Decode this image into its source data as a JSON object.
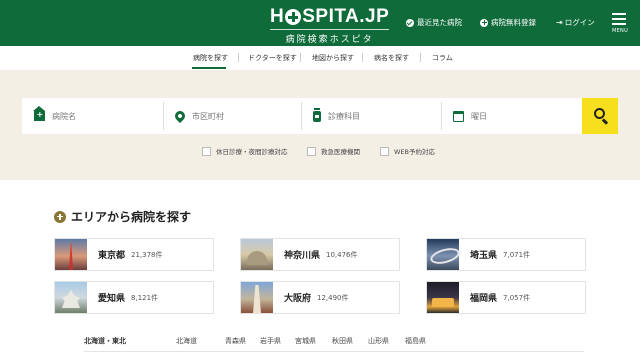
{
  "header": {
    "logo_main_1": "H",
    "logo_main_2": "SPITA.JP",
    "logo_sub": "病院検索ホスピタ",
    "nav": {
      "recent": "最近見た病院",
      "register": "病院無料登録",
      "login": "ログイン",
      "menu": "MENU"
    },
    "brand_color": "#0f6b3a"
  },
  "subnav": {
    "items": [
      "病院を探す",
      "ドクターを探す",
      "地図から探す",
      "病名を探す",
      "コラム"
    ],
    "active": "病院を探す"
  },
  "search": {
    "fields": [
      {
        "placeholder": "病院名",
        "icon": "hospital-icon"
      },
      {
        "placeholder": "市区町村",
        "icon": "location-pin-icon"
      },
      {
        "placeholder": "診療科目",
        "icon": "medicine-icon"
      },
      {
        "placeholder": "曜日",
        "icon": "calendar-icon"
      }
    ],
    "button_icon": "search-icon",
    "button_color": "#f7df1e",
    "checks": [
      "休日診療・夜間診療対応",
      "救急医療機関",
      "WEB予約対応"
    ]
  },
  "area": {
    "title": "エリアから病院を探す",
    "prefectures": [
      {
        "name": "東京都",
        "count": "21,378件"
      },
      {
        "name": "神奈川県",
        "count": "10,476件"
      },
      {
        "name": "埼玉県",
        "count": "7,071件"
      },
      {
        "name": "愛知県",
        "count": "8,121件"
      },
      {
        "name": "大阪府",
        "count": "12,490件"
      },
      {
        "name": "福岡県",
        "count": "7,057件"
      }
    ],
    "region": {
      "label": "北海道・東北",
      "prefs": [
        "北海道",
        "青森県",
        "岩手県",
        "宮城県",
        "秋田県",
        "山形県",
        "福島県"
      ]
    }
  }
}
